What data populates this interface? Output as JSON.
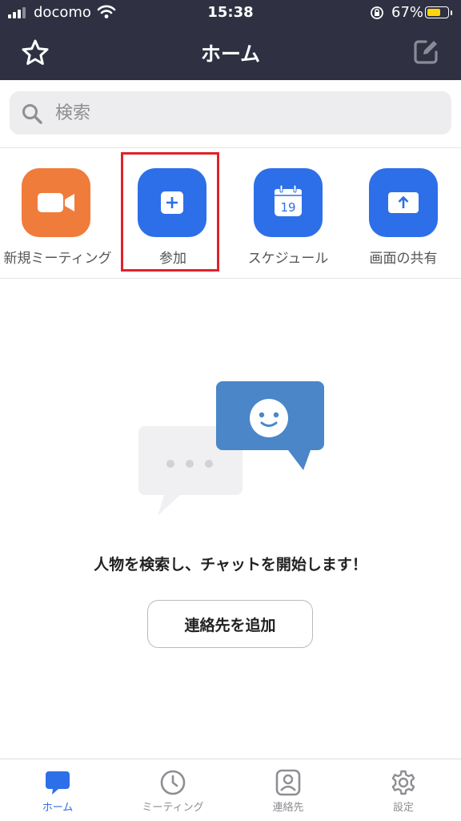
{
  "status_bar": {
    "carrier": "docomo",
    "time": "15:38",
    "battery": "67%",
    "battery_level": 0.67
  },
  "nav": {
    "title": "ホーム"
  },
  "search": {
    "placeholder": "検索"
  },
  "actions": [
    {
      "label": "新規ミーティング",
      "color": "#f07c3b"
    },
    {
      "label": "参加",
      "color": "#2d6fe8"
    },
    {
      "label": "スケジュール",
      "color": "#2d6fe8",
      "calendar_day": "19"
    },
    {
      "label": "画面の共有",
      "color": "#2d6fe8"
    }
  ],
  "empty_state": {
    "message": "人物を検索し、チャットを開始します！",
    "button_label": "連絡先を追加"
  },
  "tabs": [
    {
      "label": "ホーム",
      "active": true
    },
    {
      "label": "ミーティング",
      "active": false
    },
    {
      "label": "連絡先",
      "active": false
    },
    {
      "label": "設定",
      "active": false
    }
  ],
  "colors": {
    "header_bg": "#2f3142",
    "accent": "#2d6fe8",
    "highlight": "#e0222b"
  }
}
